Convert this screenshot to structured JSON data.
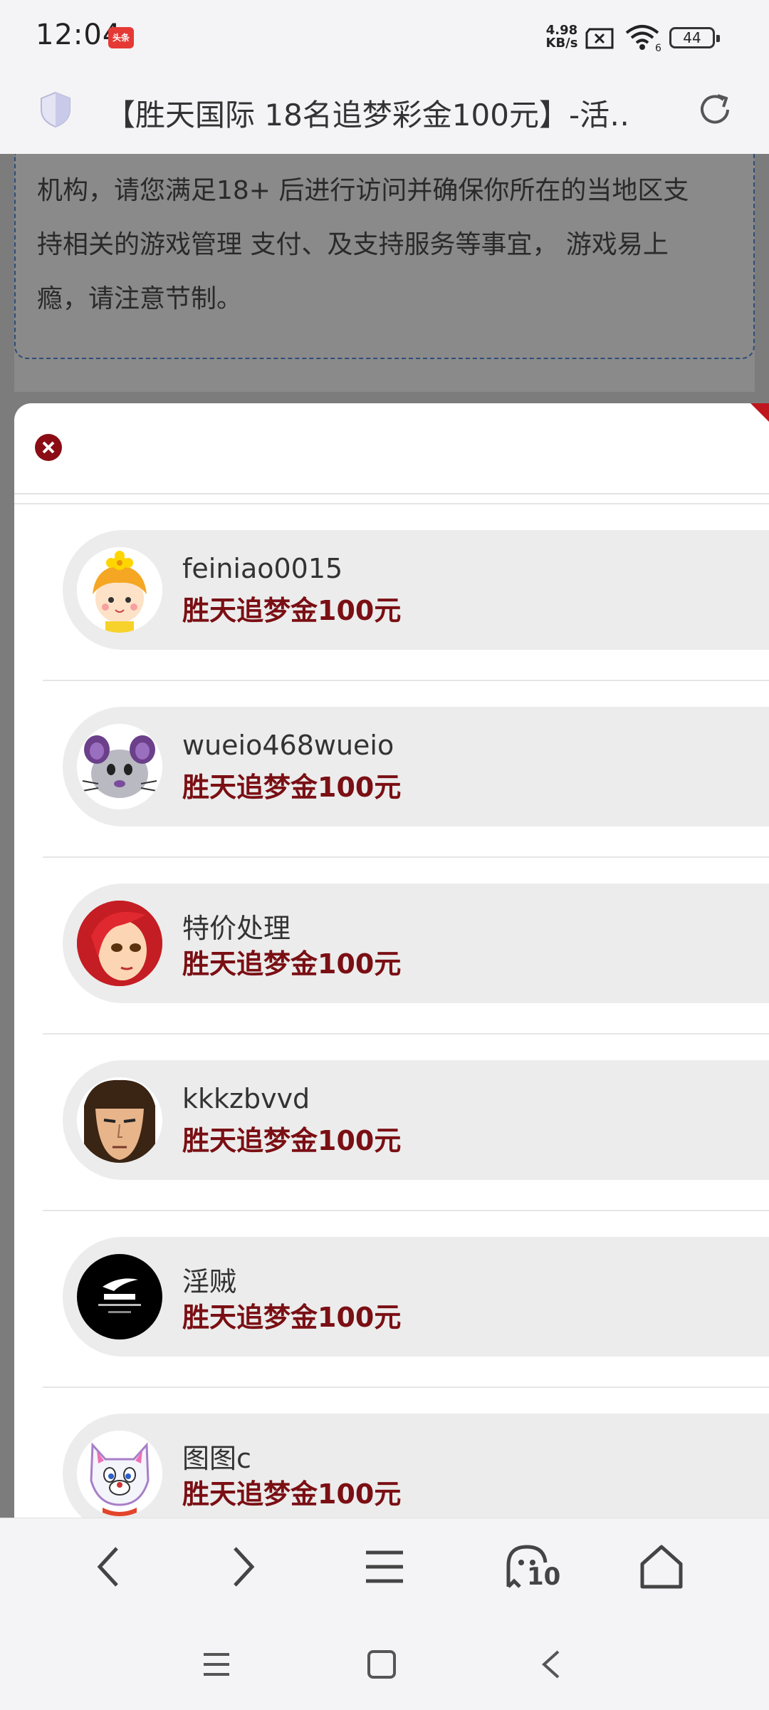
{
  "status_bar": {
    "time": "12:04",
    "app_icon_text": "头条",
    "net_speed_value": "4.98",
    "net_speed_unit": "KB/s",
    "wifi_label": "6",
    "battery": "44"
  },
  "address_bar": {
    "title": "【胜天国际 18名追梦彩金100元】-活…",
    "security_icon": "shield-icon",
    "refresh_icon": "refresh-icon"
  },
  "background_page": {
    "notice_lines": [
      "机构，请您满足18+ 后进行访问并确保你所在的当地区支",
      "持相关的游戏管理 支付、及支持服务等事宜， 游戏易上",
      "瘾，请注意节制。"
    ]
  },
  "sheet": {
    "close_icon": "close-icon",
    "accent_color": "#c0161e",
    "winners": [
      {
        "name": "feiniao0015",
        "prize": "胜天追梦金100元",
        "avatar": "cartoon-girl-avatar"
      },
      {
        "name": "wueio468wueio",
        "prize": "胜天追梦金100元",
        "avatar": "cartoon-mouse-avatar"
      },
      {
        "name": "特价处理",
        "prize": "胜天追梦金100元",
        "avatar": "red-hair-girl-avatar"
      },
      {
        "name": "kkkzbvvd",
        "prize": "胜天追梦金100元",
        "avatar": "cartoon-man-avatar"
      },
      {
        "name": "淫贼",
        "prize": "胜天追梦金100元",
        "avatar": "li-ning-logo-avatar"
      },
      {
        "name": "图图c",
        "prize": "胜天追梦金100元",
        "avatar": "cartoon-cat-avatar"
      }
    ]
  },
  "browser_toolbar": {
    "back_icon": "chevron-left-icon",
    "forward_icon": "chevron-right-icon",
    "menu_icon": "menu-icon",
    "tabs_icon": "ghost-tabs-icon",
    "tab_count": "10",
    "home_icon": "home-icon"
  },
  "system_nav": {
    "recents_icon": "recents-icon",
    "home_icon": "square-home-icon",
    "back_icon": "back-triangle-icon"
  }
}
